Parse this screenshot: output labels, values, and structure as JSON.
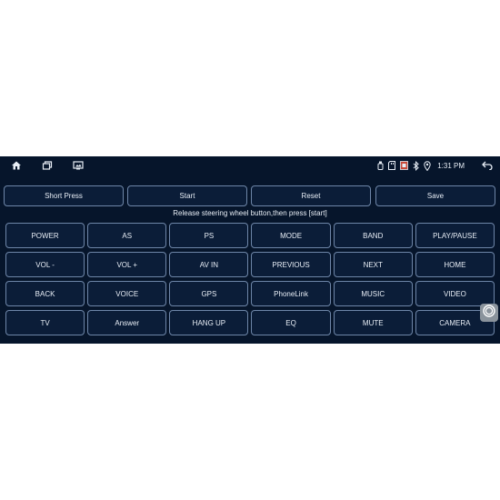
{
  "status_bar": {
    "time": "1:31 PM",
    "icons_left": [
      "home-icon",
      "recent-apps-icon",
      "screenshot-icon"
    ],
    "icons_right": [
      "usb-icon",
      "sd-card-icon",
      "sim-icon",
      "bluetooth-icon",
      "location-icon",
      "back-icon"
    ]
  },
  "toolbar": {
    "short_press_label": "Short Press",
    "start_label": "Start",
    "reset_label": "Reset",
    "save_label": "Save"
  },
  "instruction": "Release steering wheel button,then press [start]",
  "keys": [
    [
      "POWER",
      "AS",
      "PS",
      "MODE",
      "BAND",
      "PLAY/PAUSE"
    ],
    [
      "VOL -",
      "VOL +",
      "AV IN",
      "PREVIOUS",
      "NEXT",
      "HOME"
    ],
    [
      "BACK",
      "VOICE",
      "GPS",
      "PhoneLink",
      "MUSIC",
      "VIDEO"
    ],
    [
      "TV",
      "Answer",
      "HANG UP",
      "EQ",
      "MUTE",
      "CAMERA"
    ]
  ],
  "colors": {
    "background": "#06152b",
    "button_fill": "#0b1d38",
    "button_border": "#6e86a8",
    "text": "#e8eef6"
  }
}
